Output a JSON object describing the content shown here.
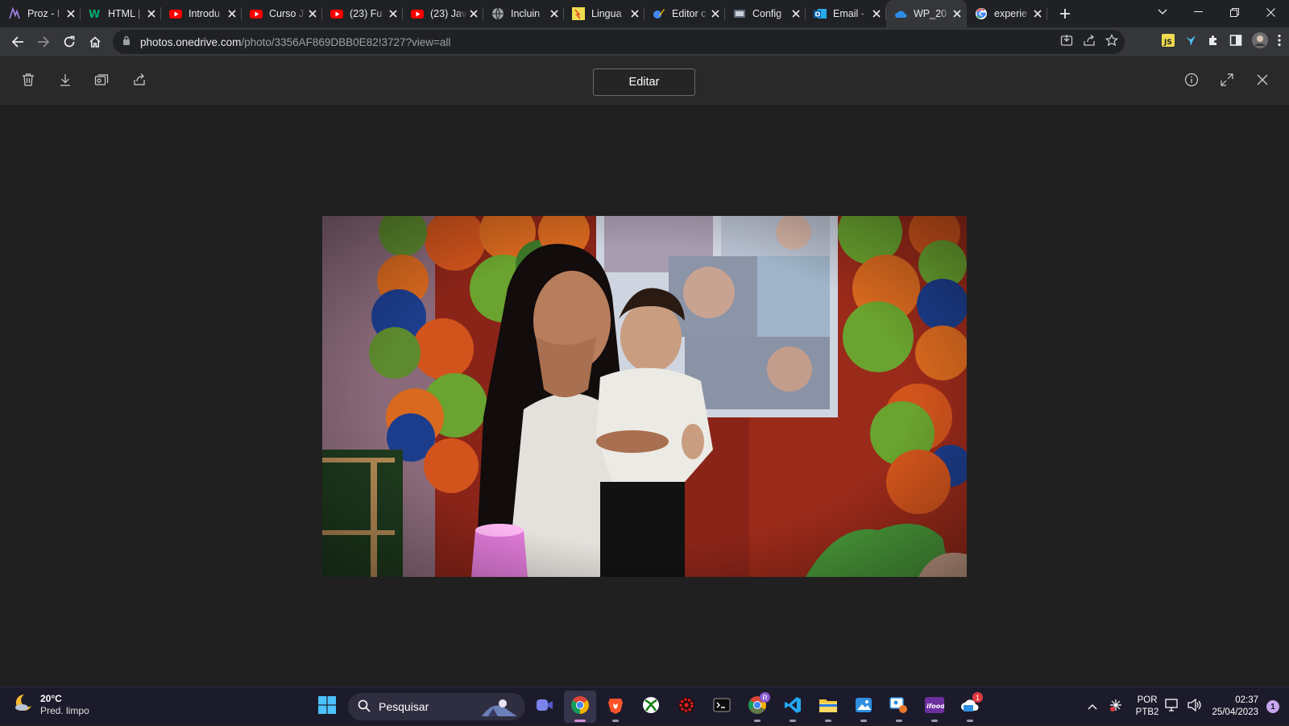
{
  "browser": {
    "tabs": [
      {
        "title": "Proz - I",
        "icon": "proz-icon"
      },
      {
        "title": "HTML |",
        "icon": "w3schools-icon"
      },
      {
        "title": "Introdu",
        "icon": "youtube-icon"
      },
      {
        "title": "Curso J",
        "icon": "youtube-icon"
      },
      {
        "title": "(23) Fu",
        "icon": "youtube-icon"
      },
      {
        "title": "(23) Jav",
        "icon": "youtube-icon"
      },
      {
        "title": "Incluin",
        "icon": "globe-icon"
      },
      {
        "title": "Lingua",
        "icon": "js-icon"
      },
      {
        "title": "Editor c",
        "icon": "editor-icon"
      },
      {
        "title": "Config",
        "icon": "config-icon"
      },
      {
        "title": "Email -",
        "icon": "outlook-icon"
      },
      {
        "title": "WP_20",
        "icon": "onedrive-icon",
        "active": true
      },
      {
        "title": "experie",
        "icon": "google-icon"
      }
    ],
    "url_host": "photos.onedrive.com",
    "url_path": "/photo/3356AF869DBB0E82!3727?view=all"
  },
  "viewer": {
    "edit_label": "Editar",
    "photo_description": "Mulher sorrindo segurando um bebê em frente a uma parede vermelha decorada com balões verdes, laranja e azuis"
  },
  "taskbar": {
    "weather_temp": "20°C",
    "weather_desc": "Pred. limpo",
    "search_placeholder": "Pesquisar",
    "lang_line1": "POR",
    "lang_line2": "PTB2",
    "time": "02:37",
    "date": "25/04/2023",
    "notification_count": "1",
    "mail_badge": "1",
    "chrome_profile_badge": "R"
  },
  "colors": {
    "accent": "#0078d4",
    "taskbar_bg": "#1c1b2c",
    "viewer_bg": "#202020"
  }
}
